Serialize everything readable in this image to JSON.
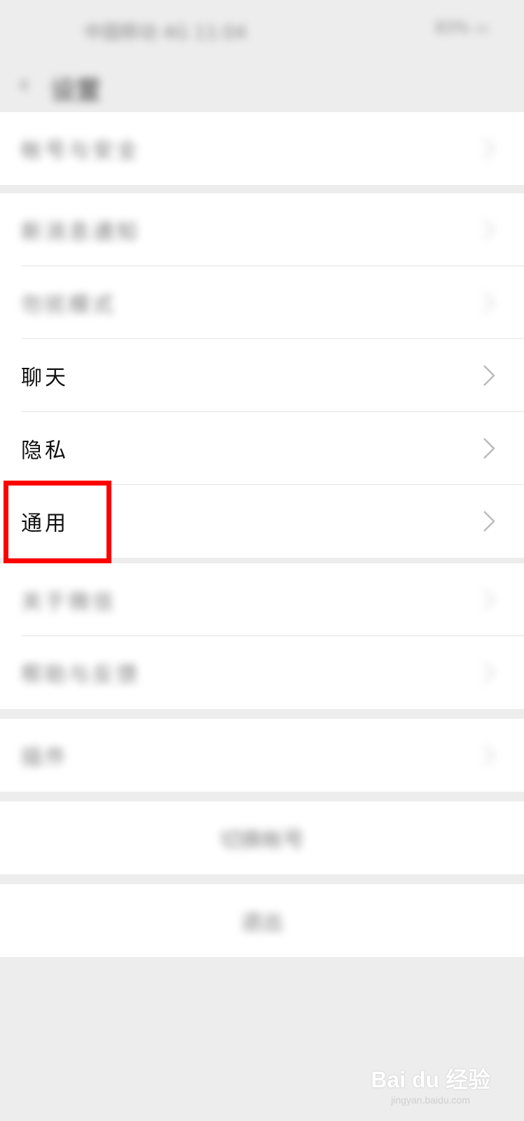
{
  "status_bar": {
    "left_text": "中国移动 4G 11:04",
    "right_text": "83% ▭"
  },
  "nav": {
    "title": "设置"
  },
  "groups": [
    {
      "items": [
        {
          "label": "帐号与安全",
          "blurred": true
        }
      ]
    },
    {
      "items": [
        {
          "label": "新消息通知",
          "blurred": true
        },
        {
          "label": "勿扰模式",
          "blurred": true
        },
        {
          "label": "聊天",
          "blurred": false
        },
        {
          "label": "隐私",
          "blurred": false
        },
        {
          "label": "通用",
          "blurred": false,
          "highlighted": true
        }
      ]
    },
    {
      "items": [
        {
          "label": "关于微信",
          "blurred": true
        },
        {
          "label": "帮助与反馈",
          "blurred": true
        }
      ]
    },
    {
      "items": [
        {
          "label": "插件",
          "blurred": true
        }
      ]
    },
    {
      "items": [
        {
          "label": "切换帐号",
          "blurred": true
        }
      ]
    },
    {
      "items": [
        {
          "label": "退出",
          "blurred": true
        }
      ]
    }
  ],
  "highlight_color": "#ff0000",
  "watermark": {
    "main": "Bai du 经验",
    "sub": "jingyan.baidu.com"
  }
}
